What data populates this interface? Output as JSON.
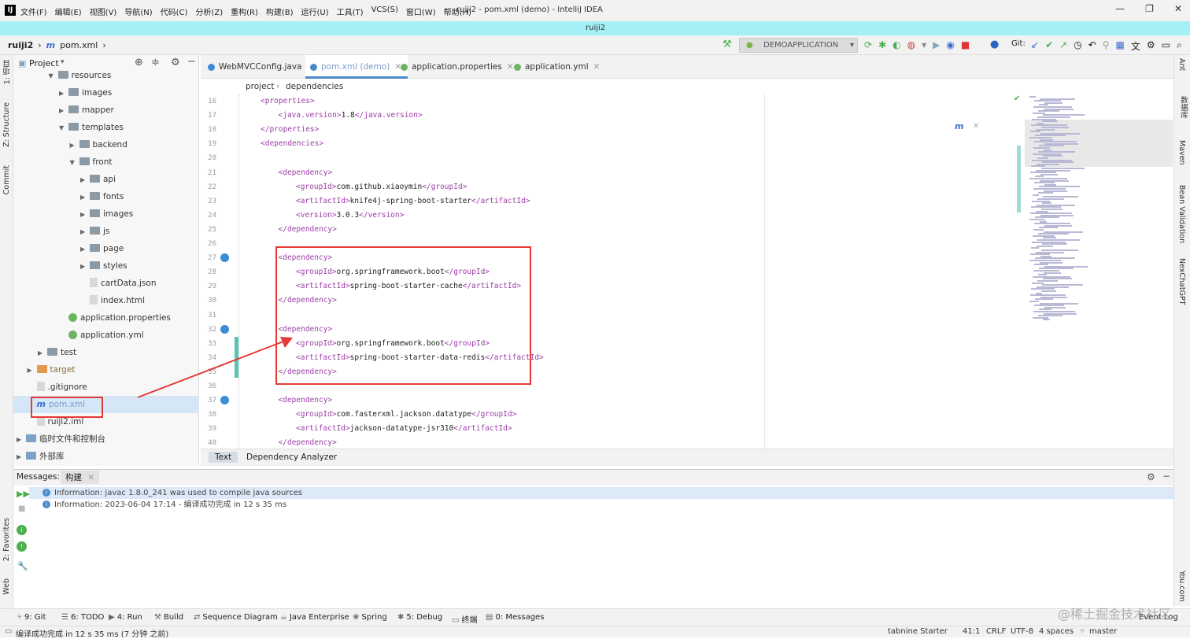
{
  "menubar": {
    "logo": "IJ",
    "menus": [
      "文件(F)",
      "编辑(E)",
      "视图(V)",
      "导航(N)",
      "代码(C)",
      "分析(Z)",
      "重构(R)",
      "构建(B)",
      "运行(U)",
      "工具(T)",
      "VCS(S)",
      "窗口(W)",
      "帮助(H)"
    ],
    "window_title": "ruiji2 - pom.xml (demo) - IntelliJ IDEA",
    "minimize": "—",
    "restore": "❐",
    "close": "✕"
  },
  "project_band": "ruiji2",
  "navbar": {
    "project": "ruiji2",
    "file": "pom.xml",
    "run_config": "DEMOAPPLICATION",
    "git_label": "Git:"
  },
  "left_strip": {
    "project": "1: 项目",
    "structure": "Z: Structure",
    "commit": "Commit",
    "favorites": "2: Favorites",
    "web": "Web"
  },
  "project_panel": {
    "title": "Project",
    "tree": [
      {
        "label": "resources",
        "depth": 3,
        "expanded": true,
        "kind": "folder"
      },
      {
        "label": "images",
        "depth": 4,
        "expanded": false,
        "kind": "folder"
      },
      {
        "label": "mapper",
        "depth": 4,
        "expanded": false,
        "kind": "folder"
      },
      {
        "label": "templates",
        "depth": 4,
        "expanded": true,
        "kind": "folder"
      },
      {
        "label": "backend",
        "depth": 5,
        "expanded": false,
        "kind": "folder"
      },
      {
        "label": "front",
        "depth": 5,
        "expanded": true,
        "kind": "folder"
      },
      {
        "label": "api",
        "depth": 6,
        "expanded": false,
        "kind": "folder"
      },
      {
        "label": "fonts",
        "depth": 6,
        "expanded": false,
        "kind": "folder"
      },
      {
        "label": "images",
        "depth": 6,
        "expanded": false,
        "kind": "folder"
      },
      {
        "label": "js",
        "depth": 6,
        "expanded": false,
        "kind": "folder"
      },
      {
        "label": "page",
        "depth": 6,
        "expanded": false,
        "kind": "folder"
      },
      {
        "label": "styles",
        "depth": 6,
        "expanded": false,
        "kind": "folder"
      },
      {
        "label": "cartData.json",
        "depth": 6,
        "kind": "file"
      },
      {
        "label": "index.html",
        "depth": 6,
        "kind": "file"
      },
      {
        "label": "application.properties",
        "depth": 4,
        "kind": "spring"
      },
      {
        "label": "application.yml",
        "depth": 4,
        "kind": "spring"
      },
      {
        "label": "test",
        "depth": 2,
        "expanded": false,
        "kind": "folder"
      },
      {
        "label": "target",
        "depth": 1,
        "expanded": false,
        "kind": "folder-orange"
      },
      {
        "label": ".gitignore",
        "depth": 1,
        "kind": "file"
      },
      {
        "label": "pom.xml",
        "depth": 1,
        "kind": "maven",
        "selected": true
      },
      {
        "label": "ruiji2.iml",
        "depth": 1,
        "kind": "file"
      },
      {
        "label": "临时文件和控制台",
        "depth": 0,
        "expanded": false,
        "kind": "scratch"
      },
      {
        "label": "外部库",
        "depth": 0,
        "expanded": false,
        "kind": "lib"
      }
    ]
  },
  "editor": {
    "tabs": [
      {
        "label": "WebMVCConfig.java",
        "active": false
      },
      {
        "label": "pom.xml (demo)",
        "active": true
      },
      {
        "label": "application.properties",
        "active": false
      },
      {
        "label": "application.yml",
        "active": false
      }
    ],
    "breadcrumb": [
      "project",
      "dependencies"
    ],
    "lines": [
      {
        "n": "16",
        "indent": 0,
        "open": "properties",
        "text": "",
        "close": ""
      },
      {
        "n": "17",
        "indent": 1,
        "open": "java.version",
        "text": "1.8",
        "close": "java.version"
      },
      {
        "n": "18",
        "indent": 0,
        "open": "",
        "text": "",
        "close": "properties"
      },
      {
        "n": "19",
        "indent": 0,
        "open": "dependencies",
        "text": "",
        "close": ""
      },
      {
        "n": "20",
        "indent": 0,
        "open": "",
        "text": "",
        "close": ""
      },
      {
        "n": "21",
        "indent": 1,
        "open": "dependency",
        "text": "",
        "close": ""
      },
      {
        "n": "22",
        "indent": 2,
        "open": "groupId",
        "text": "com.github.xiaoymin",
        "close": "groupId"
      },
      {
        "n": "23",
        "indent": 2,
        "open": "artifactId",
        "text": "knife4j-spring-boot-starter",
        "close": "artifactId"
      },
      {
        "n": "24",
        "indent": 2,
        "open": "version",
        "text": "3.0.3",
        "close": "version"
      },
      {
        "n": "25",
        "indent": 1,
        "open": "",
        "text": "",
        "close": "dependency"
      },
      {
        "n": "26",
        "indent": 0,
        "open": "",
        "text": "",
        "close": ""
      },
      {
        "n": "27",
        "indent": 1,
        "open": "dependency",
        "text": "",
        "close": ""
      },
      {
        "n": "28",
        "indent": 2,
        "open": "groupId",
        "text": "org.springframework.boot",
        "close": "groupId"
      },
      {
        "n": "29",
        "indent": 2,
        "open": "artifactId",
        "text": "spring-boot-starter-cache",
        "close": "artifactId"
      },
      {
        "n": "30",
        "indent": 1,
        "open": "",
        "text": "",
        "close": "dependency"
      },
      {
        "n": "31",
        "indent": 0,
        "open": "",
        "text": "",
        "close": ""
      },
      {
        "n": "32",
        "indent": 1,
        "open": "dependency",
        "text": "",
        "close": ""
      },
      {
        "n": "33",
        "indent": 2,
        "open": "groupId",
        "text": "org.springframework.boot",
        "close": "groupId"
      },
      {
        "n": "34",
        "indent": 2,
        "open": "artifactId",
        "text": "spring-boot-starter-data-redis",
        "close": "artifactId"
      },
      {
        "n": "35",
        "indent": 1,
        "open": "",
        "text": "",
        "close": "dependency"
      },
      {
        "n": "36",
        "indent": 0,
        "open": "",
        "text": "",
        "close": ""
      },
      {
        "n": "37",
        "indent": 1,
        "open": "dependency",
        "text": "",
        "close": ""
      },
      {
        "n": "38",
        "indent": 2,
        "open": "groupId",
        "text": "com.fasterxml.jackson.datatype",
        "close": "groupId"
      },
      {
        "n": "39",
        "indent": 2,
        "open": "artifactId",
        "text": "jackson-datatype-jsr310",
        "close": "artifactId"
      },
      {
        "n": "40",
        "indent": 1,
        "open": "",
        "text": "",
        "close": "dependency"
      }
    ],
    "bottom_tabs": [
      "Text",
      "Dependency Analyzer"
    ]
  },
  "right_strip": [
    "Ant",
    "数据库",
    "Maven",
    "Bean Validation",
    "NexChatGPT",
    "You.com"
  ],
  "messages": {
    "title": "Messages:",
    "tab": "构建",
    "rows": [
      "Information: javac 1.8.0_241 was used to compile java sources",
      "Information: 2023-06-04 17:14 - 编译成功完成 in 12 s 35 ms"
    ]
  },
  "toolwindows": [
    "9: Git",
    "6: TODO",
    "4: Run",
    "Build",
    "Sequence Diagram",
    "Java Enterprise",
    "Spring",
    "5: Debug",
    "终端",
    "0: Messages"
  ],
  "event_log": "Event Log",
  "status": {
    "message": "编译成功完成 in 12 s 35 ms (7 分钟 之前)",
    "tabnine": "tabnine Starter",
    "position": "41:1",
    "line_sep": "CRLF",
    "encoding": "UTF-8",
    "indent": "4 spaces",
    "branch": "master"
  },
  "watermark": "@稀土掘金技术社区",
  "colors": {
    "accent": "#4a88c7",
    "highlight_box": "#e53935",
    "band": "#a4f0f4",
    "xml_tag": "#9b3fa6"
  }
}
